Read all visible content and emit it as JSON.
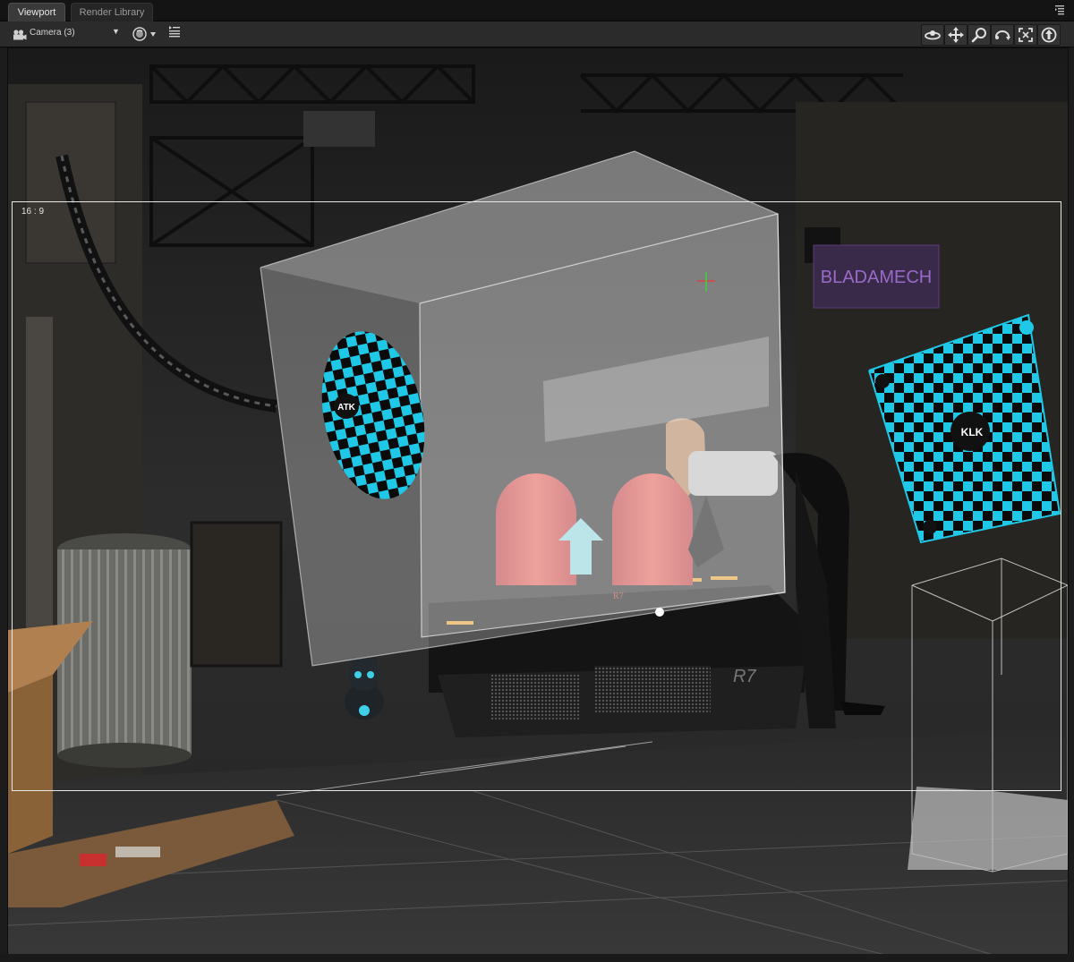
{
  "tabs": [
    {
      "label": "Viewport",
      "active": true
    },
    {
      "label": "Render Library",
      "active": false
    }
  ],
  "toolbar": {
    "camera_label": "Camera (3)",
    "camera_icon": "camera-icon",
    "drawstyle_icon": "draw-style-icon",
    "options_icon": "viewport-options-icon",
    "nav_tools": [
      "orbit-icon",
      "pan-icon",
      "zoom-icon",
      "roll-icon",
      "frame-icon",
      "reset-view-icon"
    ]
  },
  "viewport": {
    "aspect_label": "16 : 9",
    "scene_signs": {
      "checker_disk_text": "ATK",
      "checker_square_text": "KLK",
      "car_badge_rear": "R7",
      "car_badge_front": "R7",
      "neon_sign": "BLADAMECH"
    }
  },
  "colors": {
    "checker_cyan": "#1ec8e6",
    "checker_black": "#0a0a0a",
    "seat_red": "#d8463f",
    "ui_bg": "#1c1c1c",
    "toolbar_bg": "#2b2b2b"
  }
}
